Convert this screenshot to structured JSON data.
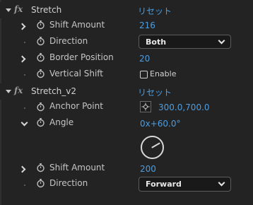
{
  "effects": [
    {
      "name": "Stretch",
      "reset_label": "リセット",
      "properties": {
        "shift_amount": {
          "label": "Shift Amount",
          "value": "216"
        },
        "direction": {
          "label": "Direction",
          "value": "Both"
        },
        "border_position": {
          "label": "Border Position",
          "value": "20"
        },
        "vertical_shift": {
          "label": "Vertical Shift",
          "checkbox_label": "Enable",
          "checked": false
        }
      }
    },
    {
      "name": "Stretch_v2",
      "reset_label": "リセット",
      "properties": {
        "anchor_point": {
          "label": "Anchor Point",
          "value": "300.0,700.0"
        },
        "angle": {
          "label": "Angle",
          "value": "0x+60.0°",
          "degrees": 60
        },
        "shift_amount": {
          "label": "Shift Amount",
          "value": "200"
        },
        "direction": {
          "label": "Direction",
          "value": "Forward"
        }
      }
    }
  ],
  "fx_label": "fx",
  "colors": {
    "background": "#232323",
    "value_blue": "#4d9de0",
    "text": "#c9c9c9"
  }
}
